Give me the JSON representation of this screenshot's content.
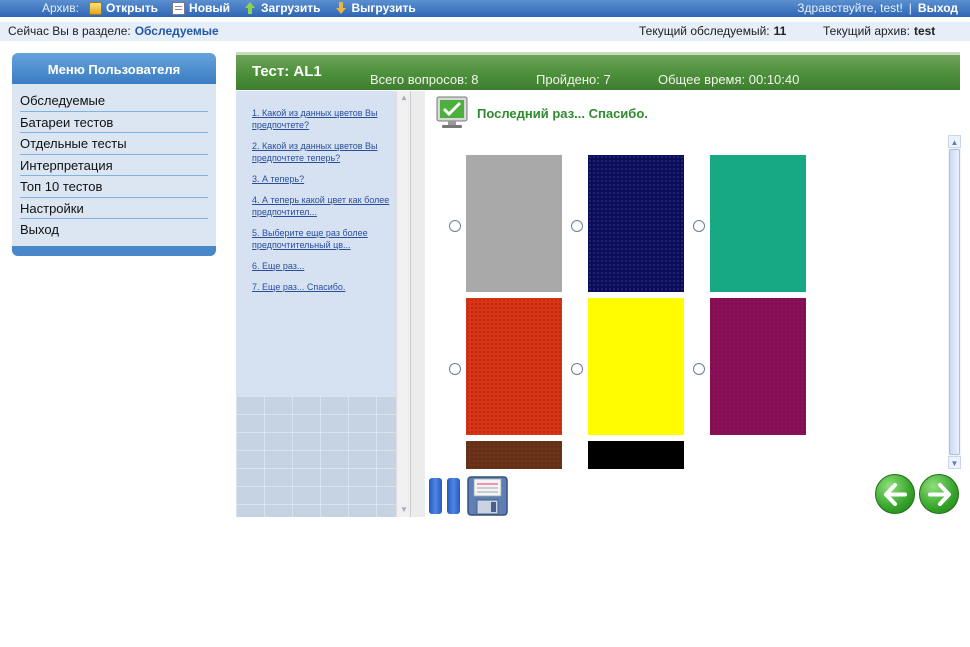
{
  "topbar": {
    "archive_label": "Архив:",
    "open_label": "Открыть",
    "new_label": "Новый",
    "upload_label": "Загрузить",
    "download_label": "Выгрузить",
    "greeting": "Здравствуйте, test!",
    "separator": "|",
    "logout_label": "Выход"
  },
  "section": {
    "current_label": "Сейчас Вы в разделе:",
    "current_value": "Обследуемые",
    "subject_label": "Текущий обследуемый:",
    "subject_value": "11",
    "archive_label": "Текущий архив:",
    "archive_value": "test"
  },
  "menu": {
    "title": "Меню Пользователя",
    "items": [
      "Обследуемые",
      "Батареи тестов",
      "Отдельные тесты",
      "Интерпретация",
      "Топ 10 тестов",
      "Настройки",
      "Выход"
    ]
  },
  "test": {
    "title": "Тест: AL1",
    "total_questions": "Всего вопросов: 8",
    "passed": "Пройдено: 7",
    "total_time": "Общее время: 00:10:40"
  },
  "questions": [
    "1. Какой из данных цветов Вы предпочтете?",
    "2. Какой из данных цветов Вы предпочтете теперь?",
    "3. А теперь?",
    "4. А теперь какой цвет как более предпочтител...",
    "5. Выберите еще раз более предпочтительный цв...",
    "6. Еще раз...",
    "7. Еще раз... Спасибо."
  ],
  "prompt": "Последний раз... Спасибо.",
  "swatches": [
    {
      "name": "grey",
      "color": "#a9a9a9"
    },
    {
      "name": "navy",
      "color": "#0c0c5c"
    },
    {
      "name": "teal",
      "color": "#17a884"
    },
    {
      "name": "red",
      "color": "#d93416"
    },
    {
      "name": "yellow",
      "color": "#fffc00"
    },
    {
      "name": "purple",
      "color": "#8c1058"
    },
    {
      "name": "brown",
      "color": "#6b3418"
    },
    {
      "name": "black",
      "color": "#000000"
    }
  ],
  "icons": {
    "open": "folder-icon",
    "new": "new-document-icon",
    "upload": "upload-arrow-icon",
    "download": "download-arrow-icon",
    "monitor": "monitor-check-icon",
    "pause": "pause-icon",
    "save": "floppy-disk-icon",
    "back": "arrow-left-icon",
    "forward": "arrow-right-icon"
  }
}
